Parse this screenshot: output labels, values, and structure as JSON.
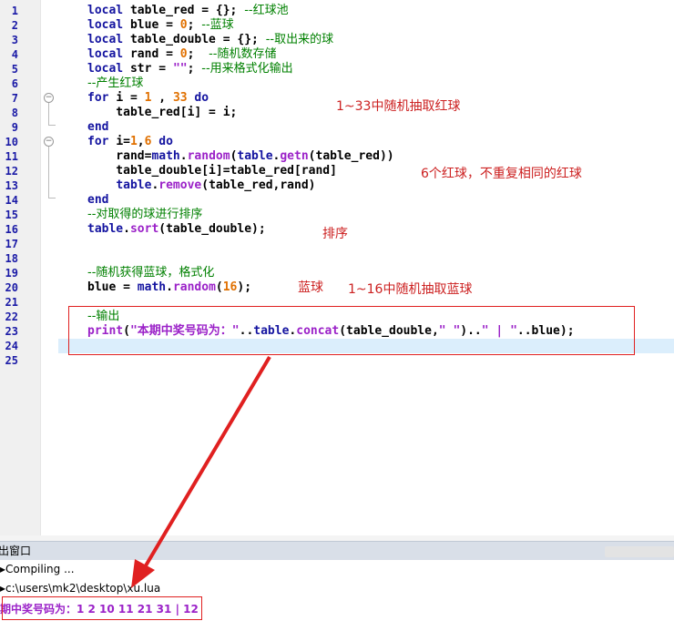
{
  "editor": {
    "line_numbers": [
      "1",
      "2",
      "3",
      "4",
      "5",
      "6",
      "7",
      "8",
      "9",
      "10",
      "11",
      "12",
      "13",
      "14",
      "15",
      "16",
      "17",
      "18",
      "19",
      "20",
      "21",
      "22",
      "23",
      "24",
      "25"
    ],
    "lines": [
      [
        {
          "t": "local ",
          "c": "kw"
        },
        {
          "t": "table_red = {}; ",
          "c": ""
        },
        {
          "t": "--红球池",
          "c": "cm"
        }
      ],
      [
        {
          "t": "local ",
          "c": "kw"
        },
        {
          "t": "blue = ",
          "c": ""
        },
        {
          "t": "0",
          "c": "num"
        },
        {
          "t": "; ",
          "c": ""
        },
        {
          "t": "--蓝球",
          "c": "cm"
        }
      ],
      [
        {
          "t": "local ",
          "c": "kw"
        },
        {
          "t": "table_double = {}; ",
          "c": ""
        },
        {
          "t": "--取出来的球",
          "c": "cm"
        }
      ],
      [
        {
          "t": "local ",
          "c": "kw"
        },
        {
          "t": "rand = ",
          "c": ""
        },
        {
          "t": "0",
          "c": "num"
        },
        {
          "t": ";  ",
          "c": ""
        },
        {
          "t": "--随机数存储",
          "c": "cm"
        }
      ],
      [
        {
          "t": "local ",
          "c": "kw"
        },
        {
          "t": "str = ",
          "c": ""
        },
        {
          "t": "\"\"",
          "c": "str"
        },
        {
          "t": "; ",
          "c": ""
        },
        {
          "t": "--用来格式化输出",
          "c": "cm"
        }
      ],
      [
        {
          "t": "--产生红球",
          "c": "cm"
        }
      ],
      [
        {
          "t": "for ",
          "c": "kw"
        },
        {
          "t": "i = ",
          "c": ""
        },
        {
          "t": "1",
          "c": "num"
        },
        {
          "t": " , ",
          "c": ""
        },
        {
          "t": "33",
          "c": "num"
        },
        {
          "t": " do",
          "c": "kw"
        }
      ],
      [
        {
          "t": "    table_red[i] = i;",
          "c": ""
        }
      ],
      [
        {
          "t": "end",
          "c": "kw"
        }
      ],
      [
        {
          "t": "for ",
          "c": "kw"
        },
        {
          "t": "i=",
          "c": ""
        },
        {
          "t": "1",
          "c": "num"
        },
        {
          "t": ",",
          "c": ""
        },
        {
          "t": "6",
          "c": "num"
        },
        {
          "t": " do",
          "c": "kw"
        }
      ],
      [
        {
          "t": "    rand=",
          "c": ""
        },
        {
          "t": "math",
          "c": "kw"
        },
        {
          "t": ".",
          "c": ""
        },
        {
          "t": "random",
          "c": "op"
        },
        {
          "t": "(",
          "c": ""
        },
        {
          "t": "table",
          "c": "kw"
        },
        {
          "t": ".",
          "c": ""
        },
        {
          "t": "getn",
          "c": "op"
        },
        {
          "t": "(table_red))",
          "c": ""
        }
      ],
      [
        {
          "t": "    table_double[i]=table_red[rand]",
          "c": ""
        }
      ],
      [
        {
          "t": "    ",
          "c": ""
        },
        {
          "t": "table",
          "c": "kw"
        },
        {
          "t": ".",
          "c": ""
        },
        {
          "t": "remove",
          "c": "op"
        },
        {
          "t": "(table_red,rand)",
          "c": ""
        }
      ],
      [
        {
          "t": "end",
          "c": "kw"
        }
      ],
      [
        {
          "t": "--对取得的球进行排序",
          "c": "cm"
        }
      ],
      [
        {
          "t": "table",
          "c": "kw"
        },
        {
          "t": ".",
          "c": ""
        },
        {
          "t": "sort",
          "c": "op"
        },
        {
          "t": "(table_double);",
          "c": ""
        }
      ],
      [],
      [],
      [
        {
          "t": "--随机获得蓝球，格式化",
          "c": "cm"
        }
      ],
      [
        {
          "t": "blue = ",
          "c": ""
        },
        {
          "t": "math",
          "c": "kw"
        },
        {
          "t": ".",
          "c": ""
        },
        {
          "t": "random",
          "c": "op"
        },
        {
          "t": "(",
          "c": ""
        },
        {
          "t": "16",
          "c": "num"
        },
        {
          "t": ");",
          "c": ""
        }
      ],
      [],
      [
        {
          "t": "--输出",
          "c": "cm"
        }
      ],
      [
        {
          "t": "print",
          "c": "op"
        },
        {
          "t": "(",
          "c": ""
        },
        {
          "t": "\"本期中奖号码为：\"",
          "c": "str"
        },
        {
          "t": "..",
          "c": ""
        },
        {
          "t": "table",
          "c": "kw"
        },
        {
          "t": ".",
          "c": ""
        },
        {
          "t": "concat",
          "c": "op"
        },
        {
          "t": "(table_double,",
          "c": ""
        },
        {
          "t": "\" \"",
          "c": "str"
        },
        {
          "t": ")..",
          "c": ""
        },
        {
          "t": "\" | \"",
          "c": "str"
        },
        {
          "t": "..blue);",
          "c": ""
        }
      ],
      [],
      []
    ]
  },
  "annotations": {
    "red_range": "1~33中随机抽取红球",
    "unique_red": "6个红球，不重复相同的红球",
    "sort": "排序",
    "blue": "蓝球",
    "blue_range": "1~16中随机抽取蓝球"
  },
  "output_panel": {
    "title": "出窗口",
    "lines": [
      "Compiling ...",
      "c:\\users\\mk2\\desktop\\xu.lua"
    ],
    "result": "期中奖号码为：1 2 10 11 21 31 | 12"
  },
  "colors": {
    "keyword": "#1414a0",
    "number": "#e07000",
    "comment": "#008000",
    "string": "#9b22c8",
    "annotation": "#cc2020"
  }
}
